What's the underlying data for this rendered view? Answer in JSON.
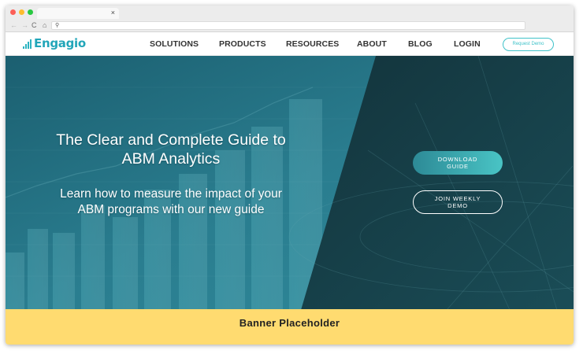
{
  "browser": {
    "tab_close": "×",
    "nav_back": "←",
    "nav_forward": "→",
    "nav_reload": "C",
    "nav_home": "⌂",
    "url_search_glyph": "⚲",
    "url": ""
  },
  "header": {
    "logo_text": "Engagio",
    "nav": [
      {
        "label": "SOLUTIONS"
      },
      {
        "label": "PRODUCTS"
      },
      {
        "label": "RESOURCES"
      },
      {
        "label": "ABOUT"
      },
      {
        "label": "BLOG"
      },
      {
        "label": "LOGIN"
      }
    ],
    "request_demo": "Request Demo"
  },
  "hero": {
    "title_line1": "The Clear and Complete Guide to",
    "title_line2": "ABM Analytics",
    "subtitle_line1": "Learn how to measure the impact of your",
    "subtitle_line2": "ABM programs with our new guide",
    "download_line1": "DOWNLOAD",
    "download_line2": "GUIDE",
    "weekly_line1": "JOIN WEEKLY",
    "weekly_line2": "DEMO"
  },
  "banner": {
    "text": "Banner Placeholder"
  },
  "colors": {
    "brand_teal": "#22a6b9",
    "hero_dark": "#163e48",
    "banner_yellow": "#ffdb70"
  }
}
